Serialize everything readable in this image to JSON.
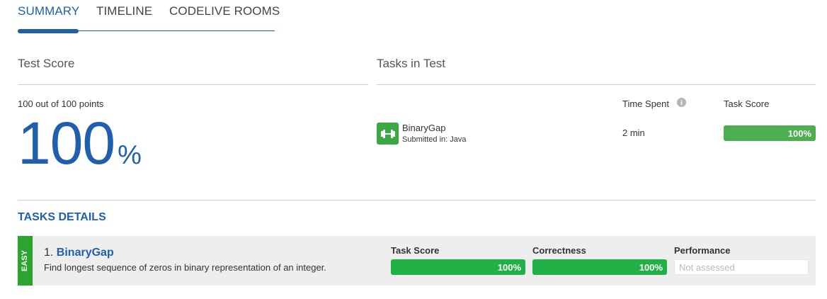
{
  "tabs": [
    {
      "label": "SUMMARY",
      "active": true
    },
    {
      "label": "TIMELINE",
      "active": false
    },
    {
      "label": "CODELIVE ROOMS",
      "active": false
    }
  ],
  "test_score": {
    "title": "Test Score",
    "points_text": "100 out of 100 points",
    "percent_value": "100",
    "percent_sign": "%"
  },
  "tasks_in_test": {
    "title": "Tasks in Test",
    "time_spent_label": "Time Spent",
    "info_icon": "info-icon",
    "task_score_label": "Task Score",
    "task": {
      "icon": "dumbbell-icon",
      "name": "BinaryGap",
      "submitted": "Submitted in: Java",
      "time": "2 min",
      "score_text": "100%",
      "score_fraction": 1.0
    }
  },
  "tasks_details": {
    "title": "TASKS DETAILS",
    "items": [
      {
        "difficulty": "EASY",
        "number": "1.",
        "name": "BinaryGap",
        "description": "Find longest sequence of zeros in binary representation of an integer.",
        "task_score_label": "Task Score",
        "task_score_text": "100%",
        "task_score_fraction": 1.0,
        "correctness_label": "Correctness",
        "correctness_text": "100%",
        "correctness_fraction": 1.0,
        "performance_label": "Performance",
        "performance_text": "Not assessed"
      }
    ]
  },
  "colors": {
    "accent": "#1f5fad",
    "success": "#4cae4f",
    "easy": "#2aa52d"
  }
}
